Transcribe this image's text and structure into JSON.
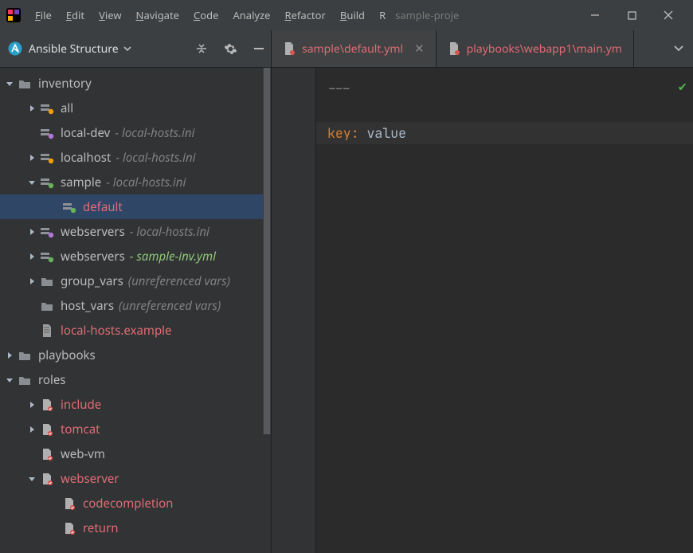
{
  "titlebar": {
    "menus": [
      "File",
      "Edit",
      "View",
      "Navigate",
      "Code",
      "Analyze",
      "Refactor",
      "Build",
      "R"
    ],
    "menu_underline_index": [
      0,
      0,
      0,
      0,
      0,
      -1,
      0,
      0,
      -1
    ],
    "project_name": "sample-proje",
    "min_tip": "Minimize",
    "max_tip": "Maximize",
    "close_tip": "Close"
  },
  "sidebar": {
    "title": "Ansible Structure",
    "toolbar": {
      "collapse": "collapse",
      "settings": "settings",
      "hide": "hide"
    }
  },
  "tree": [
    {
      "depth": 0,
      "caret": "down",
      "icon": "folder",
      "name": "inventory",
      "color": "",
      "suffix": ""
    },
    {
      "depth": 1,
      "caret": "right",
      "icon": "inv-orange",
      "name": "all",
      "color": "",
      "suffix": ""
    },
    {
      "depth": 1,
      "caret": "",
      "icon": "inv-purple",
      "name": "local-dev",
      "color": "",
      "suffix": "- local-hosts.ini"
    },
    {
      "depth": 1,
      "caret": "right",
      "icon": "inv-orange",
      "name": "localhost",
      "color": "",
      "suffix": "- local-hosts.ini"
    },
    {
      "depth": 1,
      "caret": "down",
      "icon": "inv-green",
      "name": "sample",
      "color": "",
      "suffix": "- local-hosts.ini"
    },
    {
      "depth": 2,
      "caret": "",
      "icon": "inv-green",
      "name": "default",
      "color": "red",
      "suffix": "",
      "selected": true
    },
    {
      "depth": 1,
      "caret": "right",
      "icon": "inv-purple",
      "name": "webservers",
      "color": "",
      "suffix": "- local-hosts.ini"
    },
    {
      "depth": 1,
      "caret": "right",
      "icon": "inv-green",
      "name": "webservers",
      "color": "",
      "suffix": "- sample-inv.yml",
      "suffixColor": "green"
    },
    {
      "depth": 1,
      "caret": "right",
      "icon": "folder",
      "name": "group_vars",
      "color": "",
      "suffix": "(unreferenced vars)"
    },
    {
      "depth": 1,
      "caret": "",
      "icon": "folder",
      "name": "host_vars",
      "color": "",
      "suffix": "(unreferenced vars)"
    },
    {
      "depth": 1,
      "caret": "",
      "icon": "file",
      "name": "local-hosts.example",
      "color": "red",
      "suffix": ""
    },
    {
      "depth": 0,
      "caret": "right",
      "icon": "folder",
      "name": "playbooks",
      "color": "",
      "suffix": ""
    },
    {
      "depth": 0,
      "caret": "down",
      "icon": "folder",
      "name": "roles",
      "color": "",
      "suffix": ""
    },
    {
      "depth": 1,
      "caret": "right",
      "icon": "role",
      "name": "include",
      "color": "red",
      "suffix": ""
    },
    {
      "depth": 1,
      "caret": "right",
      "icon": "role",
      "name": "tomcat",
      "color": "red",
      "suffix": ""
    },
    {
      "depth": 1,
      "caret": "",
      "icon": "role",
      "name": "web-vm",
      "color": "",
      "suffix": ""
    },
    {
      "depth": 1,
      "caret": "down",
      "icon": "role",
      "name": "webserver",
      "color": "red",
      "suffix": ""
    },
    {
      "depth": 2,
      "caret": "",
      "icon": "role",
      "name": "codecompletion",
      "color": "red",
      "suffix": ""
    },
    {
      "depth": 2,
      "caret": "",
      "icon": "role",
      "name": "return",
      "color": "red",
      "suffix": ""
    }
  ],
  "tabs": [
    {
      "label": "sample\\default.yml",
      "active": true,
      "close": true
    },
    {
      "label": "playbooks\\webapp1\\main.ym",
      "active": false,
      "close": false
    }
  ],
  "code": {
    "line1": "---",
    "key": "key",
    "colon": ": ",
    "value": "value"
  }
}
